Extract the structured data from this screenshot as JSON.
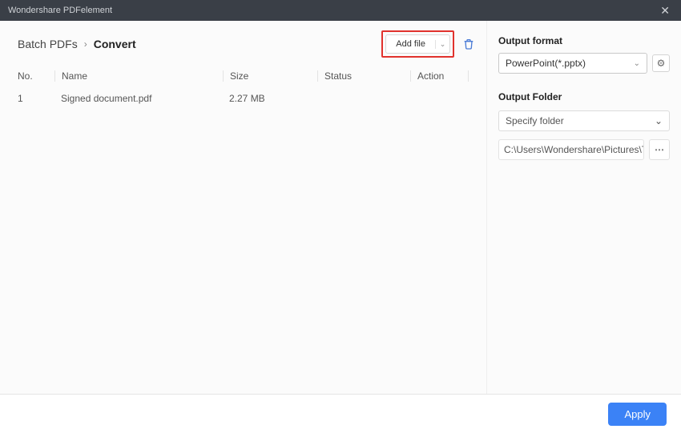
{
  "titlebar": {
    "title": "Wondershare PDFelement"
  },
  "breadcrumb": {
    "root": "Batch PDFs",
    "current": "Convert"
  },
  "addfile": {
    "label": "Add file"
  },
  "table": {
    "headers": {
      "no": "No.",
      "name": "Name",
      "size": "Size",
      "status": "Status",
      "action": "Action"
    },
    "rows": [
      {
        "no": "1",
        "name": "Signed document.pdf",
        "size": "2.27 MB",
        "status": "",
        "action": ""
      }
    ]
  },
  "output": {
    "format_label": "Output format",
    "format_value": "PowerPoint(*.pptx)",
    "folder_label": "Output Folder",
    "folder_select": "Specify folder",
    "folder_path": "C:\\Users\\Wondershare\\Pictures\\TLDR T"
  },
  "footer": {
    "apply": "Apply"
  }
}
